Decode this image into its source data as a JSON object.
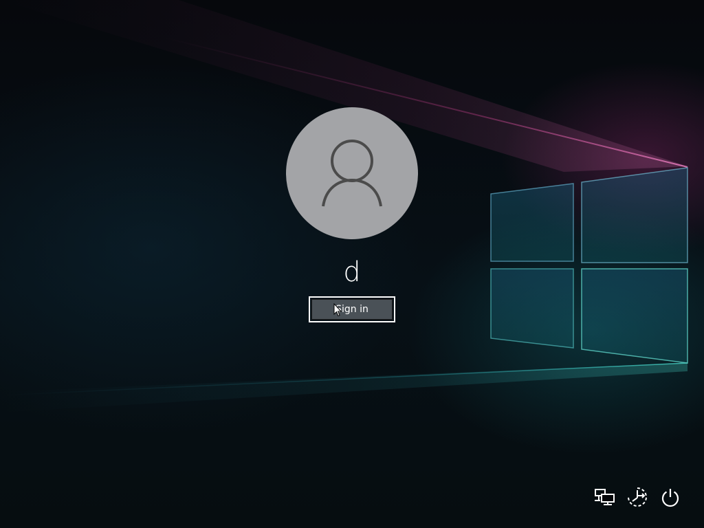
{
  "login": {
    "username": "d",
    "signin_label": "Sign in"
  },
  "icons": {
    "avatar": "user-avatar-icon",
    "network": "network-icon",
    "ease_of_access": "ease-of-access-icon",
    "power": "power-icon",
    "cursor": "mouse-pointer-icon"
  },
  "colors": {
    "avatar_bg": "#a3a4a7",
    "avatar_glyph": "#4b4b4b",
    "button_bg": "#4a5157",
    "text": "#ffffff"
  }
}
